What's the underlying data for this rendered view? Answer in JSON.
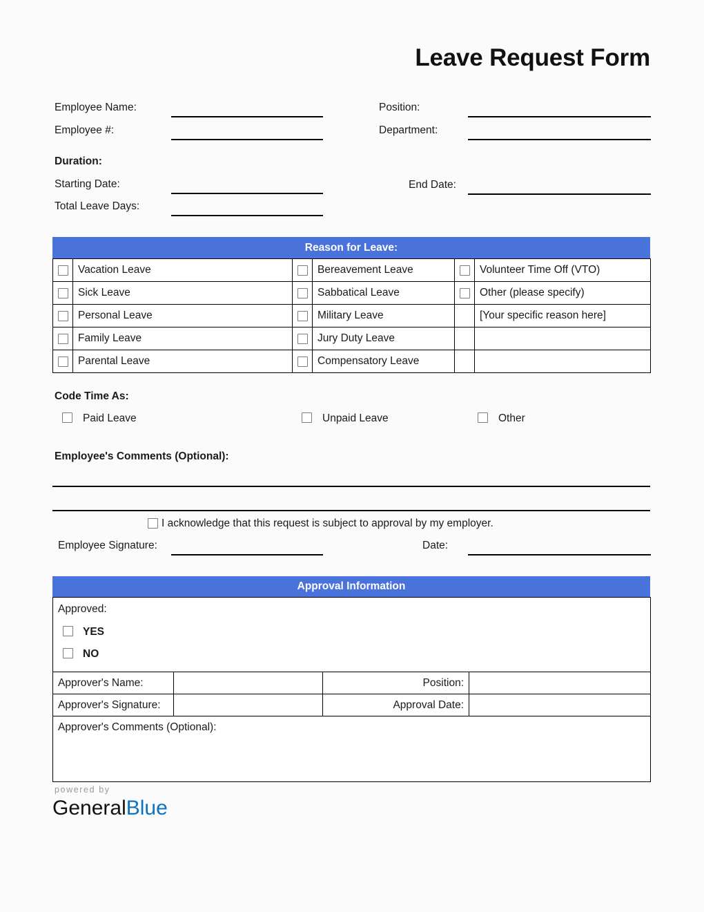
{
  "document": {
    "title": "Leave Request Form"
  },
  "employee_info": {
    "left": [
      {
        "label": "Employee Name:"
      },
      {
        "label": "Employee #:"
      }
    ],
    "right": [
      {
        "label": "Position:"
      },
      {
        "label": "Department:"
      }
    ]
  },
  "duration": {
    "heading": "Duration:",
    "starting_date_label": "Starting Date:",
    "end_date_label": "End Date:",
    "total_leave_days_label": "Total Leave Days:"
  },
  "reason_for_leave": {
    "header": "Reason for Leave:",
    "rows": [
      {
        "col1": "Vacation Leave",
        "col2": "Bereavement Leave",
        "col3": "Volunteer Time Off (VTO)",
        "col3_checkbox": true
      },
      {
        "col1": "Sick Leave",
        "col2": "Sabbatical Leave",
        "col3": "Other (please specify)",
        "col3_checkbox": true
      },
      {
        "col1": "Personal Leave",
        "col2": "Military Leave",
        "col3": "[Your specific reason here]",
        "col3_checkbox": false
      },
      {
        "col1": "Family Leave",
        "col2": "Jury Duty Leave",
        "col3": "",
        "col3_checkbox": false
      },
      {
        "col1": "Parental Leave",
        "col2": "Compensatory Leave",
        "col3": "",
        "col3_checkbox": false
      }
    ]
  },
  "code_time_as": {
    "heading": "Code Time As:",
    "options": [
      {
        "label": "Paid Leave"
      },
      {
        "label": "Unpaid Leave"
      },
      {
        "label": "Other"
      }
    ]
  },
  "employee_comments": {
    "heading": "Employee's Comments (Optional):"
  },
  "acknowledgement": {
    "text": "I acknowledge that this request is subject to approval by my employer."
  },
  "signature": {
    "employee_signature_label": "Employee Signature:",
    "date_label": "Date:"
  },
  "approval": {
    "header": "Approval Information",
    "approved_label": "Approved:",
    "yes_label": "YES",
    "no_label": "NO",
    "approver_name_label": "Approver's Name:",
    "position_label": "Position:",
    "approver_signature_label": "Approver's Signature:",
    "approval_date_label": "Approval Date:",
    "approver_comments_label": "Approver's Comments (Optional):"
  },
  "footer": {
    "powered_by": "powered by",
    "logo_primary": "General",
    "logo_secondary": "Blue"
  },
  "colors": {
    "section_header_blue": "#4a72db",
    "logo_blue": "#0c72c2",
    "checkbox_border": "#7d7d7d",
    "page_background": "#fbfbfb"
  }
}
